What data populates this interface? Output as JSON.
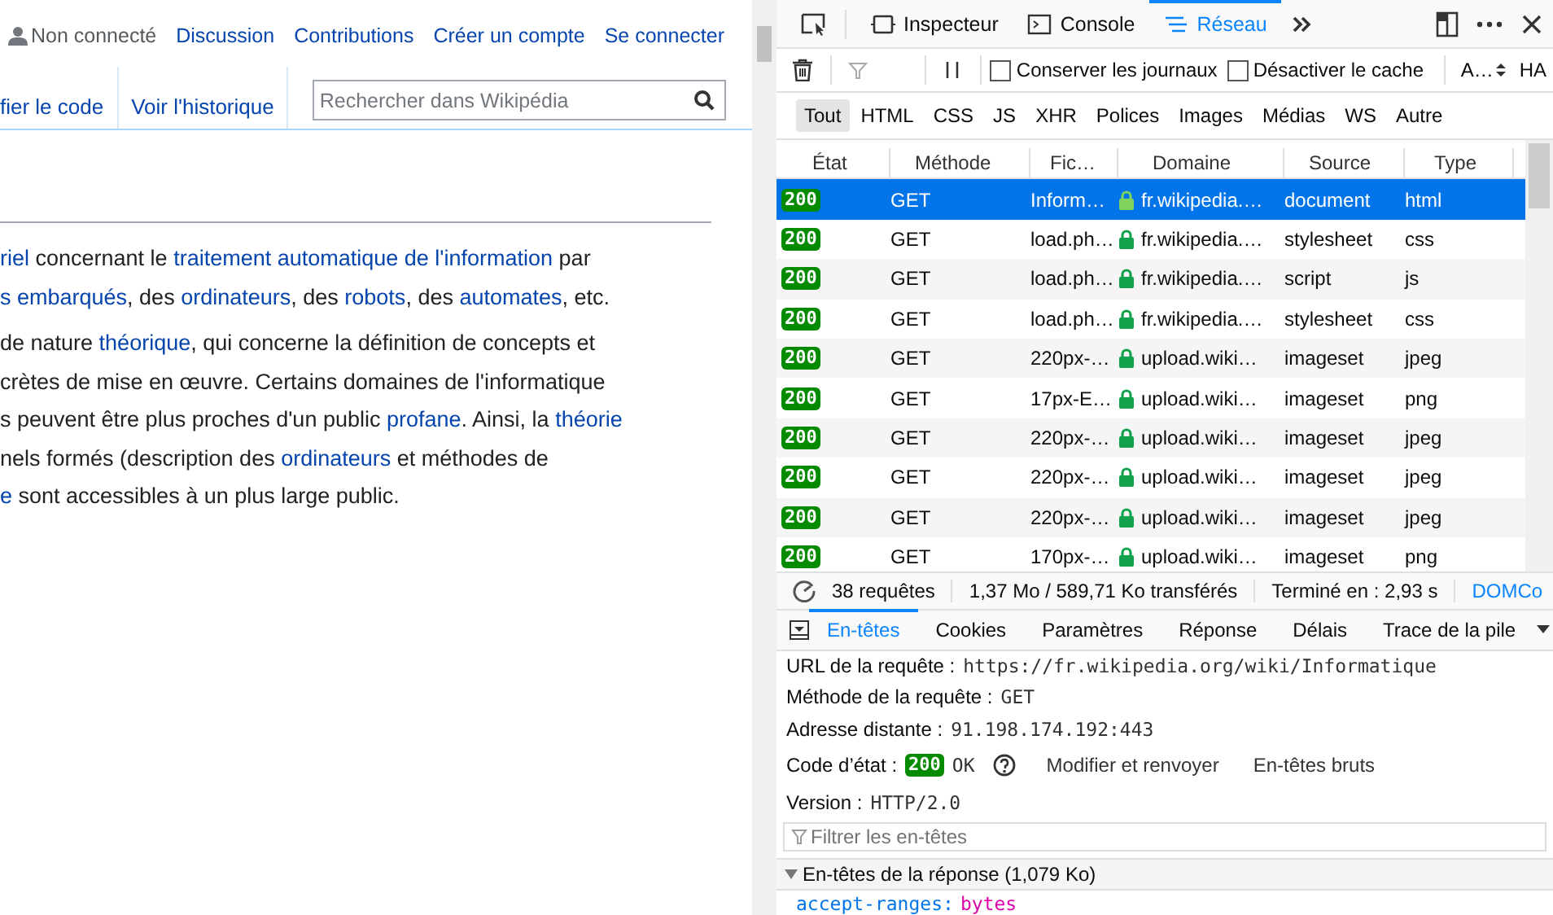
{
  "wiki": {
    "user_status": "Non connecté",
    "personal_links": [
      "Discussion",
      "Contributions",
      "Créer un compte",
      "Se connecter"
    ],
    "view_tabs": [
      "fier le code",
      "Voir l'historique"
    ],
    "search": {
      "placeholder": "Rechercher dans Wikipédia"
    },
    "paragraphs": [
      {
        "lines": [
          [
            {
              "text": "riel",
              "link": true
            },
            {
              "text": " concernant le ",
              "link": false
            },
            {
              "text": "traitement automatique de l'information",
              "link": true
            },
            {
              "text": " par",
              "link": false
            }
          ],
          [
            {
              "text": "s embarqués",
              "link": true
            },
            {
              "text": ", des ",
              "link": false
            },
            {
              "text": "ordinateurs",
              "link": true
            },
            {
              "text": ", des ",
              "link": false
            },
            {
              "text": "robots",
              "link": true
            },
            {
              "text": ", des ",
              "link": false
            },
            {
              "text": "automates",
              "link": true
            },
            {
              "text": ", etc.",
              "link": false
            }
          ]
        ]
      },
      {
        "lines": [
          [
            {
              "text": "de nature ",
              "link": false
            },
            {
              "text": "théorique",
              "link": true
            },
            {
              "text": ", qui concerne la définition de concepts et",
              "link": false
            }
          ],
          [
            {
              "text": "crètes de mise en œuvre. Certains domaines de l'informatique",
              "link": false
            }
          ],
          [
            {
              "text": "s peuvent être plus proches d'un public ",
              "link": false
            },
            {
              "text": "profane",
              "link": true
            },
            {
              "text": ". Ainsi, la ",
              "link": false
            },
            {
              "text": "théorie",
              "link": true
            }
          ],
          [
            {
              "text": "nels formés (description des ",
              "link": false
            },
            {
              "text": "ordinateurs",
              "link": true
            },
            {
              "text": " et méthodes de",
              "link": false
            }
          ],
          [
            {
              "text": "e",
              "link": true
            },
            {
              "text": " sont accessibles à un plus large public.",
              "link": false
            }
          ]
        ]
      }
    ]
  },
  "devtools": {
    "tools": [
      {
        "label": "Inspecteur",
        "kind": "inspector",
        "selected": false
      },
      {
        "label": "Console",
        "kind": "console",
        "selected": false
      },
      {
        "label": "Réseau",
        "kind": "network",
        "selected": true
      }
    ],
    "options": [
      {
        "label": "Conserver les journaux",
        "checked": false
      },
      {
        "label": "Désactiver le cache",
        "checked": false
      }
    ],
    "throttle": "A…",
    "cut_label": "HA",
    "filters": [
      {
        "label": "Tout",
        "selected": true
      },
      {
        "label": "HTML",
        "selected": false
      },
      {
        "label": "CSS",
        "selected": false
      },
      {
        "label": "JS",
        "selected": false
      },
      {
        "label": "XHR",
        "selected": false
      },
      {
        "label": "Polices",
        "selected": false
      },
      {
        "label": "Images",
        "selected": false
      },
      {
        "label": "Médias",
        "selected": false
      },
      {
        "label": "WS",
        "selected": false
      },
      {
        "label": "Autre",
        "selected": false
      }
    ],
    "columns": [
      "État",
      "Méthode",
      "Fic…",
      "Domaine",
      "Source",
      "Type"
    ],
    "rows": [
      {
        "status": "200",
        "method": "GET",
        "file": "Inform…",
        "domain": "fr.wikipedia.…",
        "source": "document",
        "type": "html",
        "selected": true
      },
      {
        "status": "200",
        "method": "GET",
        "file": "load.ph…",
        "domain": "fr.wikipedia.…",
        "source": "stylesheet",
        "type": "css",
        "selected": false
      },
      {
        "status": "200",
        "method": "GET",
        "file": "load.ph…",
        "domain": "fr.wikipedia.…",
        "source": "script",
        "type": "js",
        "selected": false
      },
      {
        "status": "200",
        "method": "GET",
        "file": "load.ph…",
        "domain": "fr.wikipedia.…",
        "source": "stylesheet",
        "type": "css",
        "selected": false
      },
      {
        "status": "200",
        "method": "GET",
        "file": "220px-…",
        "domain": "upload.wiki…",
        "source": "imageset",
        "type": "jpeg",
        "selected": false
      },
      {
        "status": "200",
        "method": "GET",
        "file": "17px-E…",
        "domain": "upload.wiki…",
        "source": "imageset",
        "type": "png",
        "selected": false
      },
      {
        "status": "200",
        "method": "GET",
        "file": "220px-…",
        "domain": "upload.wiki…",
        "source": "imageset",
        "type": "jpeg",
        "selected": false
      },
      {
        "status": "200",
        "method": "GET",
        "file": "220px-…",
        "domain": "upload.wiki…",
        "source": "imageset",
        "type": "jpeg",
        "selected": false
      },
      {
        "status": "200",
        "method": "GET",
        "file": "220px-…",
        "domain": "upload.wiki…",
        "source": "imageset",
        "type": "jpeg",
        "selected": false
      },
      {
        "status": "200",
        "method": "GET",
        "file": "170px-…",
        "domain": "upload.wiki…",
        "source": "imageset",
        "type": "png",
        "selected": false
      }
    ],
    "summary": [
      "38 requêtes",
      "1,37 Mo / 589,71 Ko transférés",
      "Terminé en : 2,93 s"
    ],
    "summary_link": "DOMCo",
    "detail_tabs": [
      {
        "label": "En-têtes",
        "selected": true
      },
      {
        "label": "Cookies",
        "selected": false
      },
      {
        "label": "Paramètres",
        "selected": false
      },
      {
        "label": "Réponse",
        "selected": false
      },
      {
        "label": "Délais",
        "selected": false
      },
      {
        "label": "Trace de la pile",
        "selected": false
      }
    ],
    "details": [
      {
        "kind": "text",
        "label": "URL de la requête :",
        "value": "https://fr.wikipedia.org/wiki/Informatique"
      },
      {
        "kind": "text",
        "label": "Méthode de la requête :",
        "value": "GET"
      },
      {
        "kind": "text",
        "label": "Adresse distante :",
        "value": "91.198.174.192:443"
      },
      {
        "kind": "status",
        "label": "Code d’état :",
        "badge": "200",
        "value": "OK",
        "actions": [
          "Modifier et renvoyer",
          "En-têtes bruts"
        ]
      },
      {
        "kind": "text",
        "label": "Version :",
        "value": "HTTP/2.0"
      }
    ],
    "header_filter": {
      "placeholder": "Filtrer les en-têtes"
    },
    "response_section": {
      "title": "En-têtes de la réponse (1,079 Ko)",
      "expanded": true
    },
    "response_headers": [
      {
        "name": "accept-ranges:",
        "value": "bytes"
      }
    ]
  }
}
